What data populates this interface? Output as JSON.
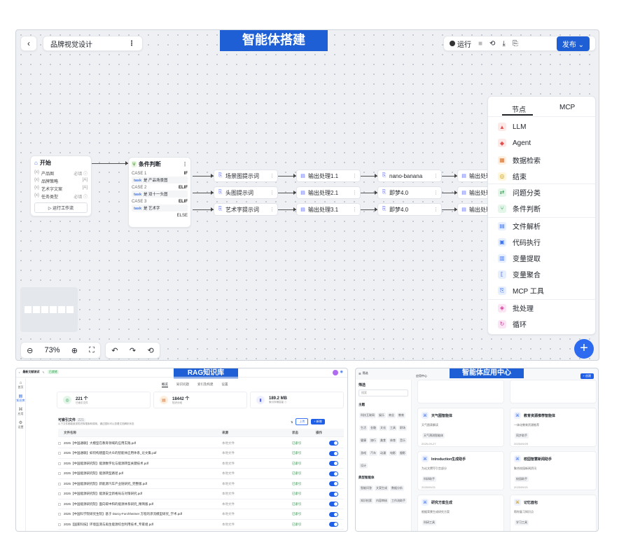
{
  "colors": {
    "accent": "#1e5fd6",
    "canvas": "#eef0f4"
  },
  "builder": {
    "banner": "智能体搭建",
    "project_name": "品牌视觉设计",
    "run_label": "运行",
    "publish_label": "发布",
    "zoom": "73%",
    "start_node": {
      "title": "开始",
      "fields": [
        {
          "prefix": "{x}",
          "name": "产品图",
          "tag": "必填 ⓘ"
        },
        {
          "prefix": "{x}",
          "name": "品牌策略",
          "tag": "[A]"
        },
        {
          "prefix": "{x}",
          "name": "艺术字文案",
          "tag": "[A]"
        },
        {
          "prefix": "{x}",
          "name": "任务类型",
          "tag": "必填 ⓘ"
        }
      ],
      "run_flow_label": "▷ 运行工作流"
    },
    "cond_node": {
      "title": "条件判断",
      "cases": [
        {
          "case": "CASE 1",
          "op": "IF",
          "rule_var": "task",
          "rule_text": "是 产品场景图"
        },
        {
          "case": "CASE 2",
          "op": "ELIF",
          "rule_var": "task",
          "rule_text": "是 双十一头图"
        },
        {
          "case": "CASE 3",
          "op": "ELIF",
          "rule_var": "task",
          "rule_text": "是 艺术字"
        }
      ],
      "else_label": "ELSE"
    },
    "branches": [
      [
        "场景图提示词",
        "输出处理1.1",
        "nano-banana",
        "输出处理"
      ],
      [
        "头图提示词",
        "输出处理2.1",
        "即梦4.0",
        "输出处理"
      ],
      [
        "艺术字提示词",
        "输出处理3.1",
        "即梦4.0",
        "输出处理"
      ]
    ],
    "menu": {
      "tabs": [
        "节点",
        "MCP"
      ],
      "items": [
        "LLM",
        "Agent",
        "数据检索",
        "结束",
        "问题分类",
        "条件判断",
        "文件解析",
        "代码执行",
        "变量提取",
        "变量聚合",
        "MCP 工具",
        "批处理",
        "循环"
      ]
    }
  },
  "kb": {
    "banner": "RAG知识库",
    "title": "最新文献测试",
    "title_badge": "已就绪",
    "left_nav": [
      "首页",
      "知识库",
      "应用",
      "设置"
    ],
    "tabs": [
      "概览",
      "知识问题",
      "索引及构建",
      "设置"
    ],
    "stats": [
      {
        "value": "221 个",
        "label": "已索引文件"
      },
      {
        "value": "18442 个",
        "label": "知识分段"
      },
      {
        "value": "189.2 MB",
        "label": "索引存储容量 ⓘ"
      }
    ],
    "list_title": "可索引文件",
    "list_count": "221",
    "list_sub": "以下文件都能被该知识库搜索和调用，通过图标可以查看文档解析状态",
    "upload_label": "上传",
    "add_label": "+ 新增",
    "columns": [
      "文件名称",
      "来源",
      "状态",
      "操作"
    ],
    "rows": [
      {
        "name": "2025【中国通联】大模型在教育领域的应用实践.pdf",
        "source": "本地文件",
        "status": "已索引"
      },
      {
        "name": "2025【中国通联】如何构建面向大众的智能体应用体系_论文集.pdf",
        "source": "本地文件",
        "status": "已索引"
      },
      {
        "name": "2025【中国能源研究院】能源数字化与能源转型关键技术.pdf",
        "source": "本地文件",
        "status": "已索引"
      },
      {
        "name": "2025【中国能源研究院】能源转型路径.pdf",
        "source": "本地文件",
        "status": "已索引"
      },
      {
        "name": "2025【中国能源研究院】新能源汽车产业链研究_完整版.pdf",
        "source": "本地文件",
        "status": "已索引"
      },
      {
        "name": "2025【中国能源研究院】能源安全新格局与对策研究.pdf",
        "source": "本地文件",
        "status": "已索引"
      },
      {
        "name": "2025【中国能源研究院】面向碳中和的能源体系研究_精简版.pdf",
        "source": "本地文件",
        "status": "已索引"
      },
      {
        "name": "2025【中国科学院研究生院】基于 Darcy-Forchheimer 方程的渗流模型研究_学术.pdf",
        "source": "本地文件",
        "status": "已索引"
      },
      {
        "name": "2025【国家科技】环境监测与再生能源综合利用技术_专家组.pdf",
        "source": "本地文件",
        "status": "已索引"
      }
    ]
  },
  "apps": {
    "banner": "智能体应用中心",
    "nav_title": "应用中心",
    "create_label": "+ 创建",
    "filter_title": "筛选",
    "search_placeholder": "搜索",
    "sec_topics": "主题",
    "topic_tags": [
      "科技互联网",
      "娱乐",
      "商业",
      "教育",
      "生活",
      "金融",
      "文化",
      "工具",
      "职场",
      "健康",
      "旅行",
      "美食",
      "体育",
      "音乐",
      "游戏",
      "汽车",
      "动漫",
      "电影",
      "摄影",
      "设计"
    ],
    "sec_tasks": "典型智能体",
    "task_tags": [
      "智能问答",
      "文案生成",
      "数据分析",
      "知识检索",
      "内容审核",
      "工作流助手"
    ],
    "cards": [
      {
        "title": "天气图智能体",
        "desc": "天气图表解读",
        "date": "2025-09-27",
        "tag": "天气预测智能体"
      },
      {
        "title": "教育资源推荐智能体",
        "desc": "一体化教育资源推荐",
        "date": "2025/09/25",
        "tag": "同步助手"
      },
      {
        "title": "Introduction生成助手",
        "desc": "为论文撰写引言部分",
        "date": "2025/09/21",
        "tag": "科研助手"
      },
      {
        "title": "校园智慧新闻助手",
        "desc": "聚合校园新闻资讯",
        "date": "2025/09/21",
        "tag": "校园助手"
      },
      {
        "title": "研究方案生成",
        "desc": "根据背景生成研究方案",
        "date": "",
        "tag": "科研工具"
      },
      {
        "title": "记忆面包",
        "desc": "帮你复习知识点",
        "date": "",
        "tag": "学习工具"
      }
    ]
  }
}
